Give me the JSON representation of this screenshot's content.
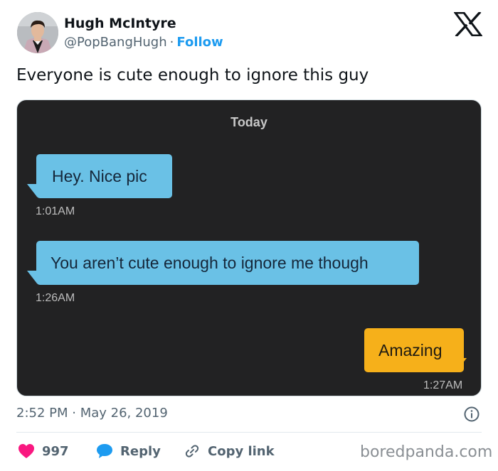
{
  "author": {
    "name": "Hugh McIntyre",
    "handle": "@PopBangHugh",
    "separator": "·",
    "follow_label": "Follow"
  },
  "tweet": {
    "text": "Everyone is cute enough to ignore this guy",
    "timestamp": "2:52 PM · May 26, 2019"
  },
  "chat": {
    "day_label": "Today",
    "messages": [
      {
        "direction": "incoming",
        "text": "Hey. Nice pic",
        "time": "1:01AM"
      },
      {
        "direction": "incoming",
        "text": "You aren’t cute enough to ignore me though",
        "time": "1:26AM"
      },
      {
        "direction": "outgoing",
        "text": "Amazing",
        "time": "1:27AM"
      }
    ]
  },
  "actions": {
    "like_count": "997",
    "reply_label": "Reply",
    "copy_link_label": "Copy link"
  },
  "watermark": "boredpanda.com",
  "icons": {
    "logo": "x-logo-icon",
    "info": "info-icon",
    "like": "heart-icon",
    "reply": "speech-bubble-icon",
    "copy_link": "link-icon"
  },
  "colors": {
    "follow": "#1d9bf0",
    "heart": "#f91880",
    "reply_bubble": "#1d9bf0",
    "incoming_bubble": "#6ac1e6",
    "outgoing_bubble": "#f6b01a",
    "chat_background": "#222223"
  }
}
